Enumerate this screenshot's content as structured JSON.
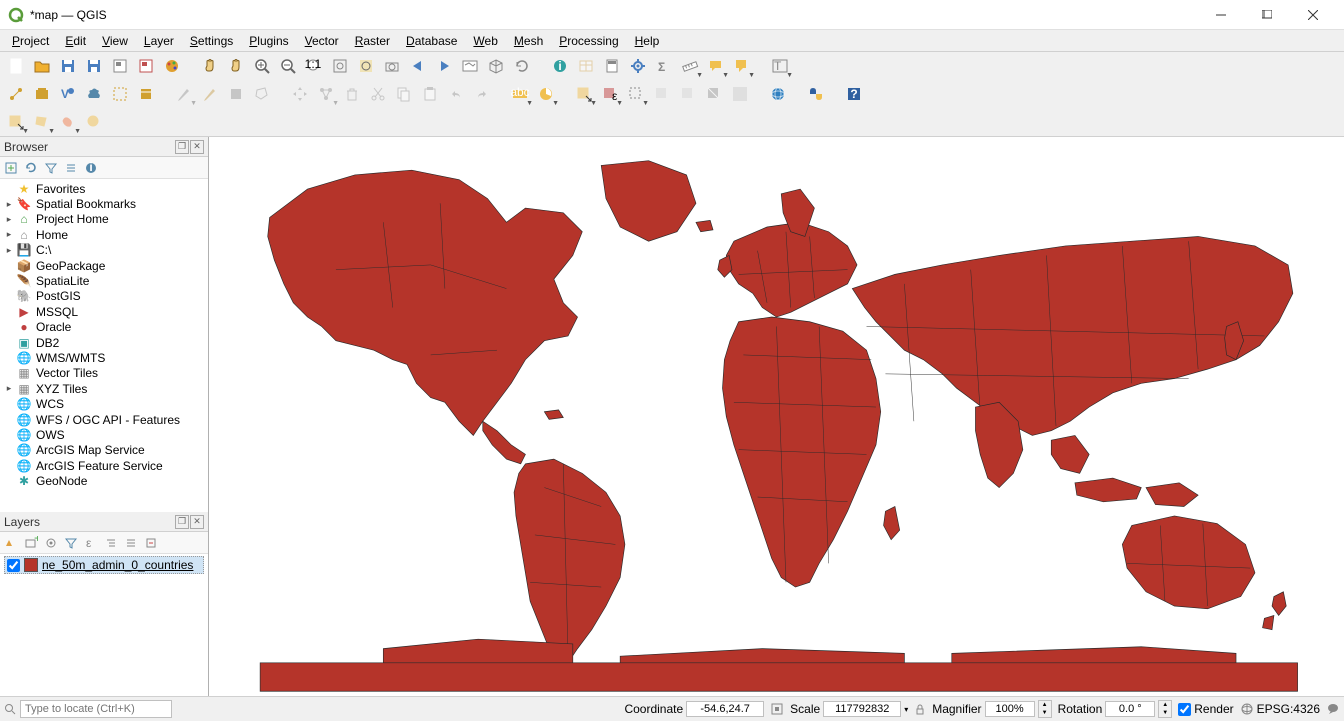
{
  "titlebar": {
    "title": "*map — QGIS"
  },
  "menus": [
    "Project",
    "Edit",
    "View",
    "Layer",
    "Settings",
    "Plugins",
    "Vector",
    "Raster",
    "Database",
    "Web",
    "Mesh",
    "Processing",
    "Help"
  ],
  "toolbar1": [
    {
      "n": "new-project",
      "c": "#fff",
      "t": "page"
    },
    {
      "n": "open-project",
      "c": "#f0b030",
      "t": "folder"
    },
    {
      "n": "save-project",
      "c": "#4a7fc0",
      "t": "floppy"
    },
    {
      "n": "save-as",
      "c": "#4a7fc0",
      "t": "floppy"
    },
    {
      "n": "new-layout",
      "c": "#888",
      "t": "layout"
    },
    {
      "n": "layout-manager",
      "c": "#c05050",
      "t": "layout"
    },
    {
      "n": "style-manager",
      "c": "#e0a030",
      "t": "palette"
    },
    {
      "sep": true
    },
    {
      "n": "pan",
      "c": "#f0d088",
      "t": "hand"
    },
    {
      "n": "pan-selection",
      "c": "#f0d088",
      "t": "hand"
    },
    {
      "n": "zoom-in",
      "c": "#666",
      "t": "zoomin"
    },
    {
      "n": "zoom-out",
      "c": "#666",
      "t": "zoomout"
    },
    {
      "n": "zoom-native",
      "c": "#888",
      "t": "zoomratio"
    },
    {
      "n": "zoom-full",
      "c": "#888",
      "t": "zoomfull"
    },
    {
      "n": "zoom-selection",
      "c": "#f0d060",
      "t": "zoomsel"
    },
    {
      "n": "zoom-layer",
      "c": "#888",
      "t": "zoomlayer"
    },
    {
      "n": "zoom-last",
      "c": "#4a7fc0",
      "t": "arrowl"
    },
    {
      "n": "zoom-next",
      "c": "#4a7fc0",
      "t": "arrowr"
    },
    {
      "n": "new-map-view",
      "c": "#888",
      "t": "mapview"
    },
    {
      "n": "new-3d-view",
      "c": "#888",
      "t": "3d"
    },
    {
      "n": "refresh",
      "c": "#888",
      "t": "refresh"
    },
    {
      "sep": true
    },
    {
      "n": "identify",
      "c": "#30a0a0",
      "t": "info"
    },
    {
      "n": "open-attribute-table",
      "c": "#d0a040",
      "t": "table",
      "dis": true
    },
    {
      "n": "field-calculator",
      "c": "#888",
      "t": "calc"
    },
    {
      "n": "toolbox",
      "c": "#4a7fc0",
      "t": "gear"
    },
    {
      "n": "statistics",
      "c": "#888",
      "t": "sigma"
    },
    {
      "n": "measure",
      "c": "#888",
      "t": "ruler",
      "drop": true
    },
    {
      "n": "map-tips",
      "c": "#f0c050",
      "t": "tip",
      "drop": true
    },
    {
      "n": "annotations",
      "c": "#f0c050",
      "t": "annotation",
      "drop": true
    },
    {
      "sep": true
    },
    {
      "n": "no-action",
      "c": "#888",
      "t": "text",
      "drop": true
    }
  ],
  "toolbar2": [
    {
      "n": "add-vector",
      "c": "#d0a030",
      "t": "vector"
    },
    {
      "n": "new-geopackage",
      "c": "#d0a030",
      "t": "gpkg"
    },
    {
      "n": "new-shapefile",
      "c": "#4a7fc0",
      "t": "shp"
    },
    {
      "n": "new-spatialite",
      "c": "#58a",
      "t": "spatialite"
    },
    {
      "n": "new-virtual",
      "c": "#d0a030",
      "t": "virtual"
    },
    {
      "n": "new-memory",
      "c": "#d0a030",
      "t": "memory"
    },
    {
      "sep": true
    },
    {
      "n": "current-edits",
      "c": "#888",
      "t": "pencil",
      "dis": true,
      "drop": true
    },
    {
      "n": "toggle-edit",
      "c": "#c09030",
      "t": "pencil",
      "dis": true
    },
    {
      "n": "save-edits",
      "c": "#888",
      "t": "save",
      "dis": true
    },
    {
      "n": "add-feature",
      "c": "#888",
      "t": "addpoly",
      "dis": true
    },
    {
      "sep": true
    },
    {
      "n": "move-feature",
      "c": "#888",
      "t": "move",
      "dis": true
    },
    {
      "n": "vertex-tool",
      "c": "#888",
      "t": "vertex",
      "dis": true,
      "drop": true
    },
    {
      "n": "delete-selected",
      "c": "#888",
      "t": "trash",
      "dis": true
    },
    {
      "n": "cut-features",
      "c": "#888",
      "t": "cut",
      "dis": true
    },
    {
      "n": "copy-features",
      "c": "#888",
      "t": "copy",
      "dis": true
    },
    {
      "n": "paste-features",
      "c": "#888",
      "t": "paste",
      "dis": true
    },
    {
      "n": "undo",
      "c": "#888",
      "t": "undo",
      "dis": true
    },
    {
      "n": "redo",
      "c": "#888",
      "t": "redo",
      "dis": true
    },
    {
      "sep": true
    },
    {
      "n": "label-tool",
      "c": "#f0c050",
      "t": "abc",
      "drop": true
    },
    {
      "n": "diagram-tool",
      "c": "#f0c050",
      "t": "diagram",
      "drop": true
    },
    {
      "sep": true
    },
    {
      "n": "select-features",
      "c": "#f0c050",
      "t": "selrect",
      "drop": true
    },
    {
      "n": "select-value",
      "c": "#c04040",
      "t": "selval",
      "drop": true
    },
    {
      "n": "deselect-all",
      "c": "#888",
      "t": "desel",
      "drop": true
    },
    {
      "n": "select-location",
      "c": "#888",
      "t": "selloc",
      "dis": true
    },
    {
      "n": "select-expression",
      "c": "#888",
      "t": "selexp",
      "dis": true
    },
    {
      "n": "invert-selection",
      "c": "#888",
      "t": "invert",
      "dis": true
    },
    {
      "n": "select-all",
      "c": "#888",
      "t": "selall",
      "dis": true
    },
    {
      "sep": true
    },
    {
      "n": "metasearch",
      "c": "#3080c0",
      "t": "globe"
    },
    {
      "sep": true
    },
    {
      "n": "python-console",
      "c": "#3060a0",
      "t": "python"
    },
    {
      "sep": true
    },
    {
      "n": "help",
      "c": "#3060a0",
      "t": "help"
    }
  ],
  "toolbar3": [
    {
      "n": "select-rect-tool",
      "c": "#f0c050",
      "t": "selrect",
      "drop": true
    },
    {
      "n": "select-polygon-tool",
      "c": "#f0c050",
      "t": "selpoly",
      "drop": true
    },
    {
      "n": "select-freehand",
      "c": "#f08050",
      "t": "selfree",
      "drop": true
    },
    {
      "n": "select-radius",
      "c": "#f0c050",
      "t": "selrad"
    }
  ],
  "browser": {
    "title": "Browser",
    "items": [
      {
        "n": "Favorites",
        "i": "star",
        "c": "#f0c030"
      },
      {
        "n": "Spatial Bookmarks",
        "i": "bookmark",
        "c": "#50a050",
        "exp": true
      },
      {
        "n": "Project Home",
        "i": "home",
        "c": "#50a050",
        "exp": true
      },
      {
        "n": "Home",
        "i": "home",
        "c": "#888",
        "exp": true
      },
      {
        "n": "C:\\",
        "i": "drive",
        "c": "#888",
        "exp": true
      },
      {
        "n": "GeoPackage",
        "i": "gpkg",
        "c": "#d0a030"
      },
      {
        "n": "SpatiaLite",
        "i": "feather",
        "c": "#4a7fc0"
      },
      {
        "n": "PostGIS",
        "i": "elephant",
        "c": "#336791"
      },
      {
        "n": "MSSQL",
        "i": "mssql",
        "c": "#c04040"
      },
      {
        "n": "Oracle",
        "i": "oracle",
        "c": "#c04040"
      },
      {
        "n": "DB2",
        "i": "db2",
        "c": "#30a0a0"
      },
      {
        "n": "WMS/WMTS",
        "i": "globe",
        "c": "#4a7fc0"
      },
      {
        "n": "Vector Tiles",
        "i": "grid",
        "c": "#888"
      },
      {
        "n": "XYZ Tiles",
        "i": "grid",
        "c": "#888",
        "exp": true
      },
      {
        "n": "WCS",
        "i": "globe",
        "c": "#4a7fc0"
      },
      {
        "n": "WFS / OGC API - Features",
        "i": "globe",
        "c": "#4a7fc0"
      },
      {
        "n": "OWS",
        "i": "globe",
        "c": "#4a7fc0"
      },
      {
        "n": "ArcGIS Map Service",
        "i": "globe",
        "c": "#4a7fc0"
      },
      {
        "n": "ArcGIS Feature Service",
        "i": "globe",
        "c": "#4a7fc0"
      },
      {
        "n": "GeoNode",
        "i": "asterisk",
        "c": "#30a0a0"
      }
    ]
  },
  "layers": {
    "title": "Layers",
    "items": [
      {
        "name": "ne_50m_admin_0_countries",
        "checked": true,
        "color": "#b5342a"
      }
    ]
  },
  "status": {
    "placeholder": "Type to locate (Ctrl+K)",
    "coord_label": "Coordinate",
    "coord_value": "-54.6,24.7",
    "scale_label": "Scale",
    "scale_value": "117792832",
    "mag_label": "Magnifier",
    "mag_value": "100%",
    "rot_label": "Rotation",
    "rot_value": "0.0 °",
    "render_label": "Render",
    "crs_label": "EPSG:4326"
  },
  "map": {
    "fill": "#b5342a",
    "stroke": "#2a2a2a"
  }
}
